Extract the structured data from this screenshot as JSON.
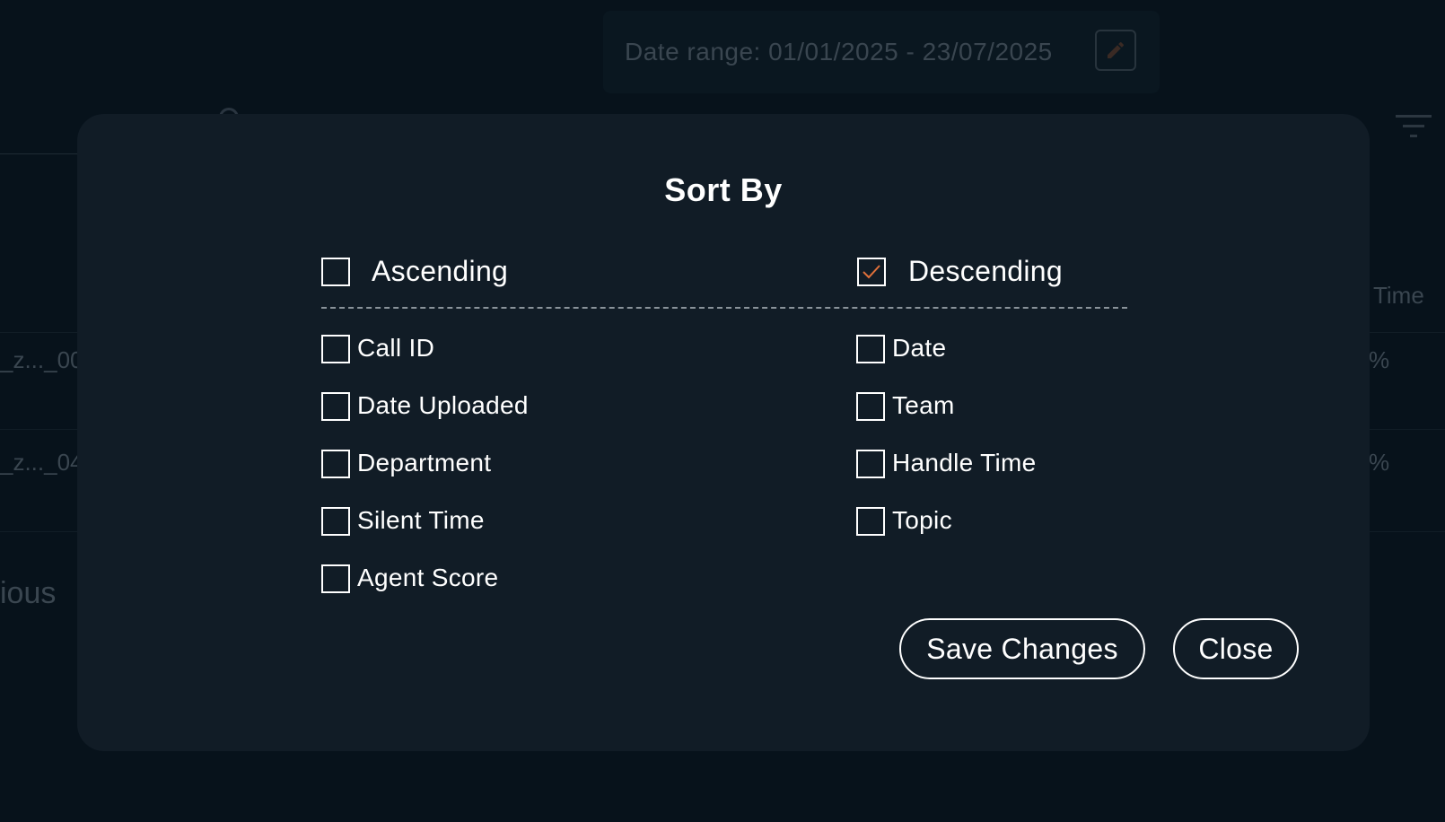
{
  "background": {
    "date_range_label": "Date range: 01/01/2025 - 23/07/2025",
    "row1_id": "_z..._00",
    "row2_id": "_z..._04",
    "row1_pct": "%",
    "row2_pct": "%",
    "column_header_partial": "t Time",
    "previous_partial": "ious"
  },
  "modal": {
    "title": "Sort By",
    "order": {
      "ascending": {
        "label": "Ascending",
        "checked": false
      },
      "descending": {
        "label": "Descending",
        "checked": true
      }
    },
    "fields_left": [
      {
        "label": "Call ID",
        "checked": false
      },
      {
        "label": "Date Uploaded",
        "checked": false
      },
      {
        "label": "Department",
        "checked": false
      },
      {
        "label": "Silent Time",
        "checked": false
      },
      {
        "label": "Agent Score",
        "checked": false
      }
    ],
    "fields_right": [
      {
        "label": "Date",
        "checked": false
      },
      {
        "label": "Team",
        "checked": false
      },
      {
        "label": "Handle Time",
        "checked": false
      },
      {
        "label": "Topic",
        "checked": false
      }
    ],
    "save_label": "Save Changes",
    "close_label": "Close"
  },
  "colors": {
    "accent_check": "#e0703a",
    "modal_bg": "#111c26",
    "page_bg": "#07121b"
  },
  "icons": [
    "pencil-icon",
    "search-icon",
    "filter-icon",
    "checkmark-icon"
  ]
}
